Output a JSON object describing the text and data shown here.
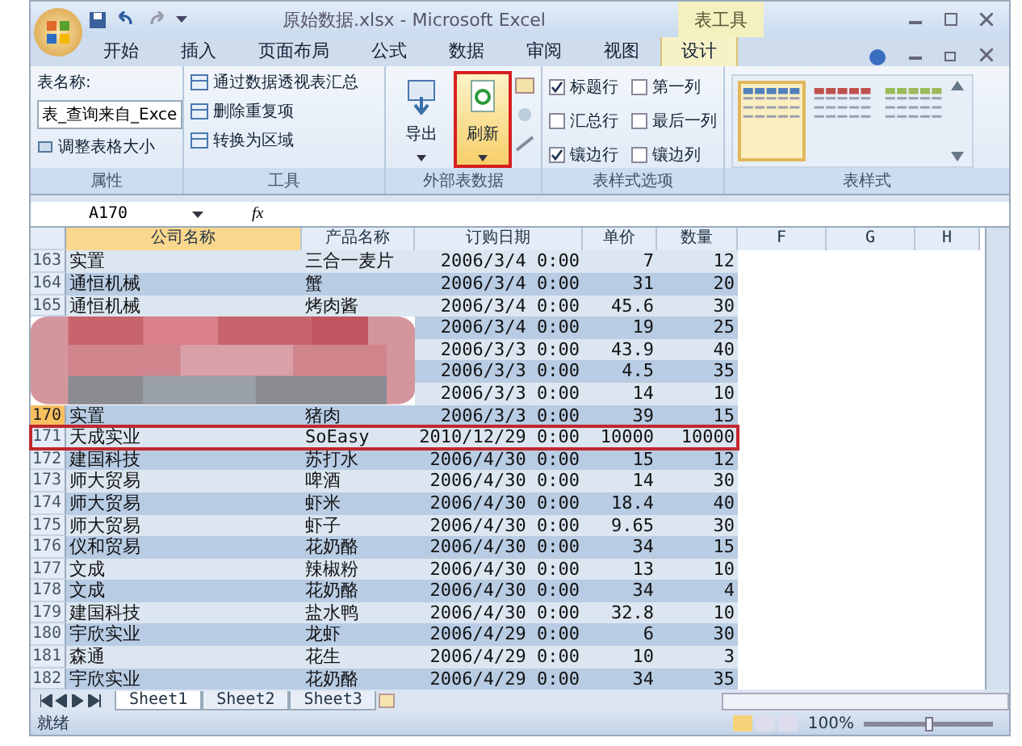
{
  "window": {
    "title": "原始数据.xlsx - Microsoft Excel",
    "context_tab": "表工具"
  },
  "tabs": [
    {
      "label": "开始",
      "selected": false
    },
    {
      "label": "插入",
      "selected": false
    },
    {
      "label": "页面布局",
      "selected": false
    },
    {
      "label": "公式",
      "selected": false
    },
    {
      "label": "数据",
      "selected": false
    },
    {
      "label": "审阅",
      "selected": false
    },
    {
      "label": "视图",
      "selected": false
    },
    {
      "label": "设计",
      "selected": true
    }
  ],
  "ribbon": [
    {
      "kind": "properties",
      "label": "属性",
      "name_label": "表名称:",
      "name_value": "表_查询来自_Exce",
      "resize": "调整表格大小"
    },
    {
      "kind": "tools",
      "label": "工具",
      "items": [
        "通过数据透视表汇总",
        "删除重复项",
        "转换为区域"
      ]
    },
    {
      "kind": "external",
      "label": "外部表数据",
      "buttons": [
        {
          "label": "导出",
          "highlighted": false
        },
        {
          "label": "刷新",
          "highlighted": true
        }
      ]
    },
    {
      "kind": "options",
      "label": "表样式选项",
      "options": [
        {
          "label": "标题行",
          "checked": true
        },
        {
          "label": "汇总行",
          "checked": false
        },
        {
          "label": "镶边行",
          "checked": true
        },
        {
          "label": "第一列",
          "checked": false
        },
        {
          "label": "最后一列",
          "checked": false
        },
        {
          "label": "镶边列",
          "checked": false
        }
      ]
    },
    {
      "kind": "styles",
      "label": "表样式",
      "swatches": [
        {
          "color": "#4f81bd",
          "selected": true
        },
        {
          "color": "#c0504d",
          "selected": false
        },
        {
          "color": "#9bbb59",
          "selected": false
        }
      ]
    }
  ],
  "formula_bar": {
    "name_box": "A170",
    "fx": "fx"
  },
  "columns": [
    {
      "label": "公司名称",
      "selected": true
    },
    {
      "label": "产品名称",
      "selected": false
    },
    {
      "label": "订购日期",
      "selected": false
    },
    {
      "label": "单价",
      "selected": false
    },
    {
      "label": "数量",
      "selected": false
    },
    {
      "label": "F",
      "selected": false
    },
    {
      "label": "G",
      "selected": false
    },
    {
      "label": "H",
      "selected": false
    }
  ],
  "rows": [
    {
      "num": "163",
      "selected": false,
      "outlined": false,
      "redacted": false,
      "company": "实置",
      "product": "三合一麦片",
      "date": "2006/3/4 0:00",
      "price": "7",
      "qty": "12"
    },
    {
      "num": "164",
      "selected": false,
      "outlined": false,
      "redacted": false,
      "company": "通恒机械",
      "product": "蟹",
      "date": "2006/3/4 0:00",
      "price": "31",
      "qty": "20"
    },
    {
      "num": "165",
      "selected": false,
      "outlined": false,
      "redacted": false,
      "company": "通恒机械",
      "product": "烤肉酱",
      "date": "2006/3/4 0:00",
      "price": "45.6",
      "qty": "30"
    },
    {
      "outlined": false,
      "redacted": true,
      "date": "2006/3/4 0:00",
      "price": "19",
      "qty": "25"
    },
    {
      "outlined": false,
      "redacted": true,
      "date": "2006/3/3 0:00",
      "price": "43.9",
      "qty": "40"
    },
    {
      "outlined": false,
      "redacted": true,
      "date": "2006/3/3 0:00",
      "price": "4.5",
      "qty": "35"
    },
    {
      "outlined": false,
      "redacted": true,
      "date": "2006/3/3 0:00",
      "price": "14",
      "qty": "10"
    },
    {
      "num": "170",
      "selected": true,
      "outlined": false,
      "redacted": false,
      "company": "实置",
      "product": "猪肉",
      "date": "2006/3/3 0:00",
      "price": "39",
      "qty": "15"
    },
    {
      "num": "171",
      "selected": false,
      "outlined": true,
      "redacted": false,
      "company": "天成实业",
      "product": "SoEasy",
      "date": "2010/12/29 0:00",
      "price": "10000",
      "qty": "10000"
    },
    {
      "num": "172",
      "selected": false,
      "outlined": false,
      "redacted": false,
      "company": "建国科技",
      "product": "苏打水",
      "date": "2006/4/30 0:00",
      "price": "15",
      "qty": "12"
    },
    {
      "num": "173",
      "selected": false,
      "outlined": false,
      "redacted": false,
      "company": "师大贸易",
      "product": "啤酒",
      "date": "2006/4/30 0:00",
      "price": "14",
      "qty": "30"
    },
    {
      "num": "174",
      "selected": false,
      "outlined": false,
      "redacted": false,
      "company": "师大贸易",
      "product": "虾米",
      "date": "2006/4/30 0:00",
      "price": "18.4",
      "qty": "40"
    },
    {
      "num": "175",
      "selected": false,
      "outlined": false,
      "redacted": false,
      "company": "师大贸易",
      "product": "虾子",
      "date": "2006/4/30 0:00",
      "price": "9.65",
      "qty": "30"
    },
    {
      "num": "176",
      "selected": false,
      "outlined": false,
      "redacted": false,
      "company": "仪和贸易",
      "product": "花奶酪",
      "date": "2006/4/30 0:00",
      "price": "34",
      "qty": "15"
    },
    {
      "num": "177",
      "selected": false,
      "outlined": false,
      "redacted": false,
      "company": "文成",
      "product": "辣椒粉",
      "date": "2006/4/30 0:00",
      "price": "13",
      "qty": "10"
    },
    {
      "num": "178",
      "selected": false,
      "outlined": false,
      "redacted": false,
      "company": "文成",
      "product": "花奶酪",
      "date": "2006/4/30 0:00",
      "price": "34",
      "qty": "4"
    },
    {
      "num": "179",
      "selected": false,
      "outlined": false,
      "redacted": false,
      "company": "建国科技",
      "product": "盐水鸭",
      "date": "2006/4/30 0:00",
      "price": "32.8",
      "qty": "10"
    },
    {
      "num": "180",
      "selected": false,
      "outlined": false,
      "redacted": false,
      "company": "宇欣实业",
      "product": "龙虾",
      "date": "2006/4/29 0:00",
      "price": "6",
      "qty": "30"
    },
    {
      "num": "181",
      "selected": false,
      "outlined": false,
      "redacted": false,
      "company": "森通",
      "product": "花生",
      "date": "2006/4/29 0:00",
      "price": "10",
      "qty": "3"
    },
    {
      "num": "182",
      "selected": false,
      "outlined": false,
      "redacted": false,
      "company": "宇欣实业",
      "product": "花奶酪",
      "date": "2006/4/29 0:00",
      "price": "34",
      "qty": "35"
    }
  ],
  "sheets": [
    {
      "label": "Sheet1",
      "selected": true
    },
    {
      "label": "Sheet2",
      "selected": false
    },
    {
      "label": "Sheet3",
      "selected": false
    }
  ],
  "status_bar": {
    "text": "就绪",
    "zoom": "100%",
    "zoom_slider": {
      "level": 0.5
    }
  }
}
